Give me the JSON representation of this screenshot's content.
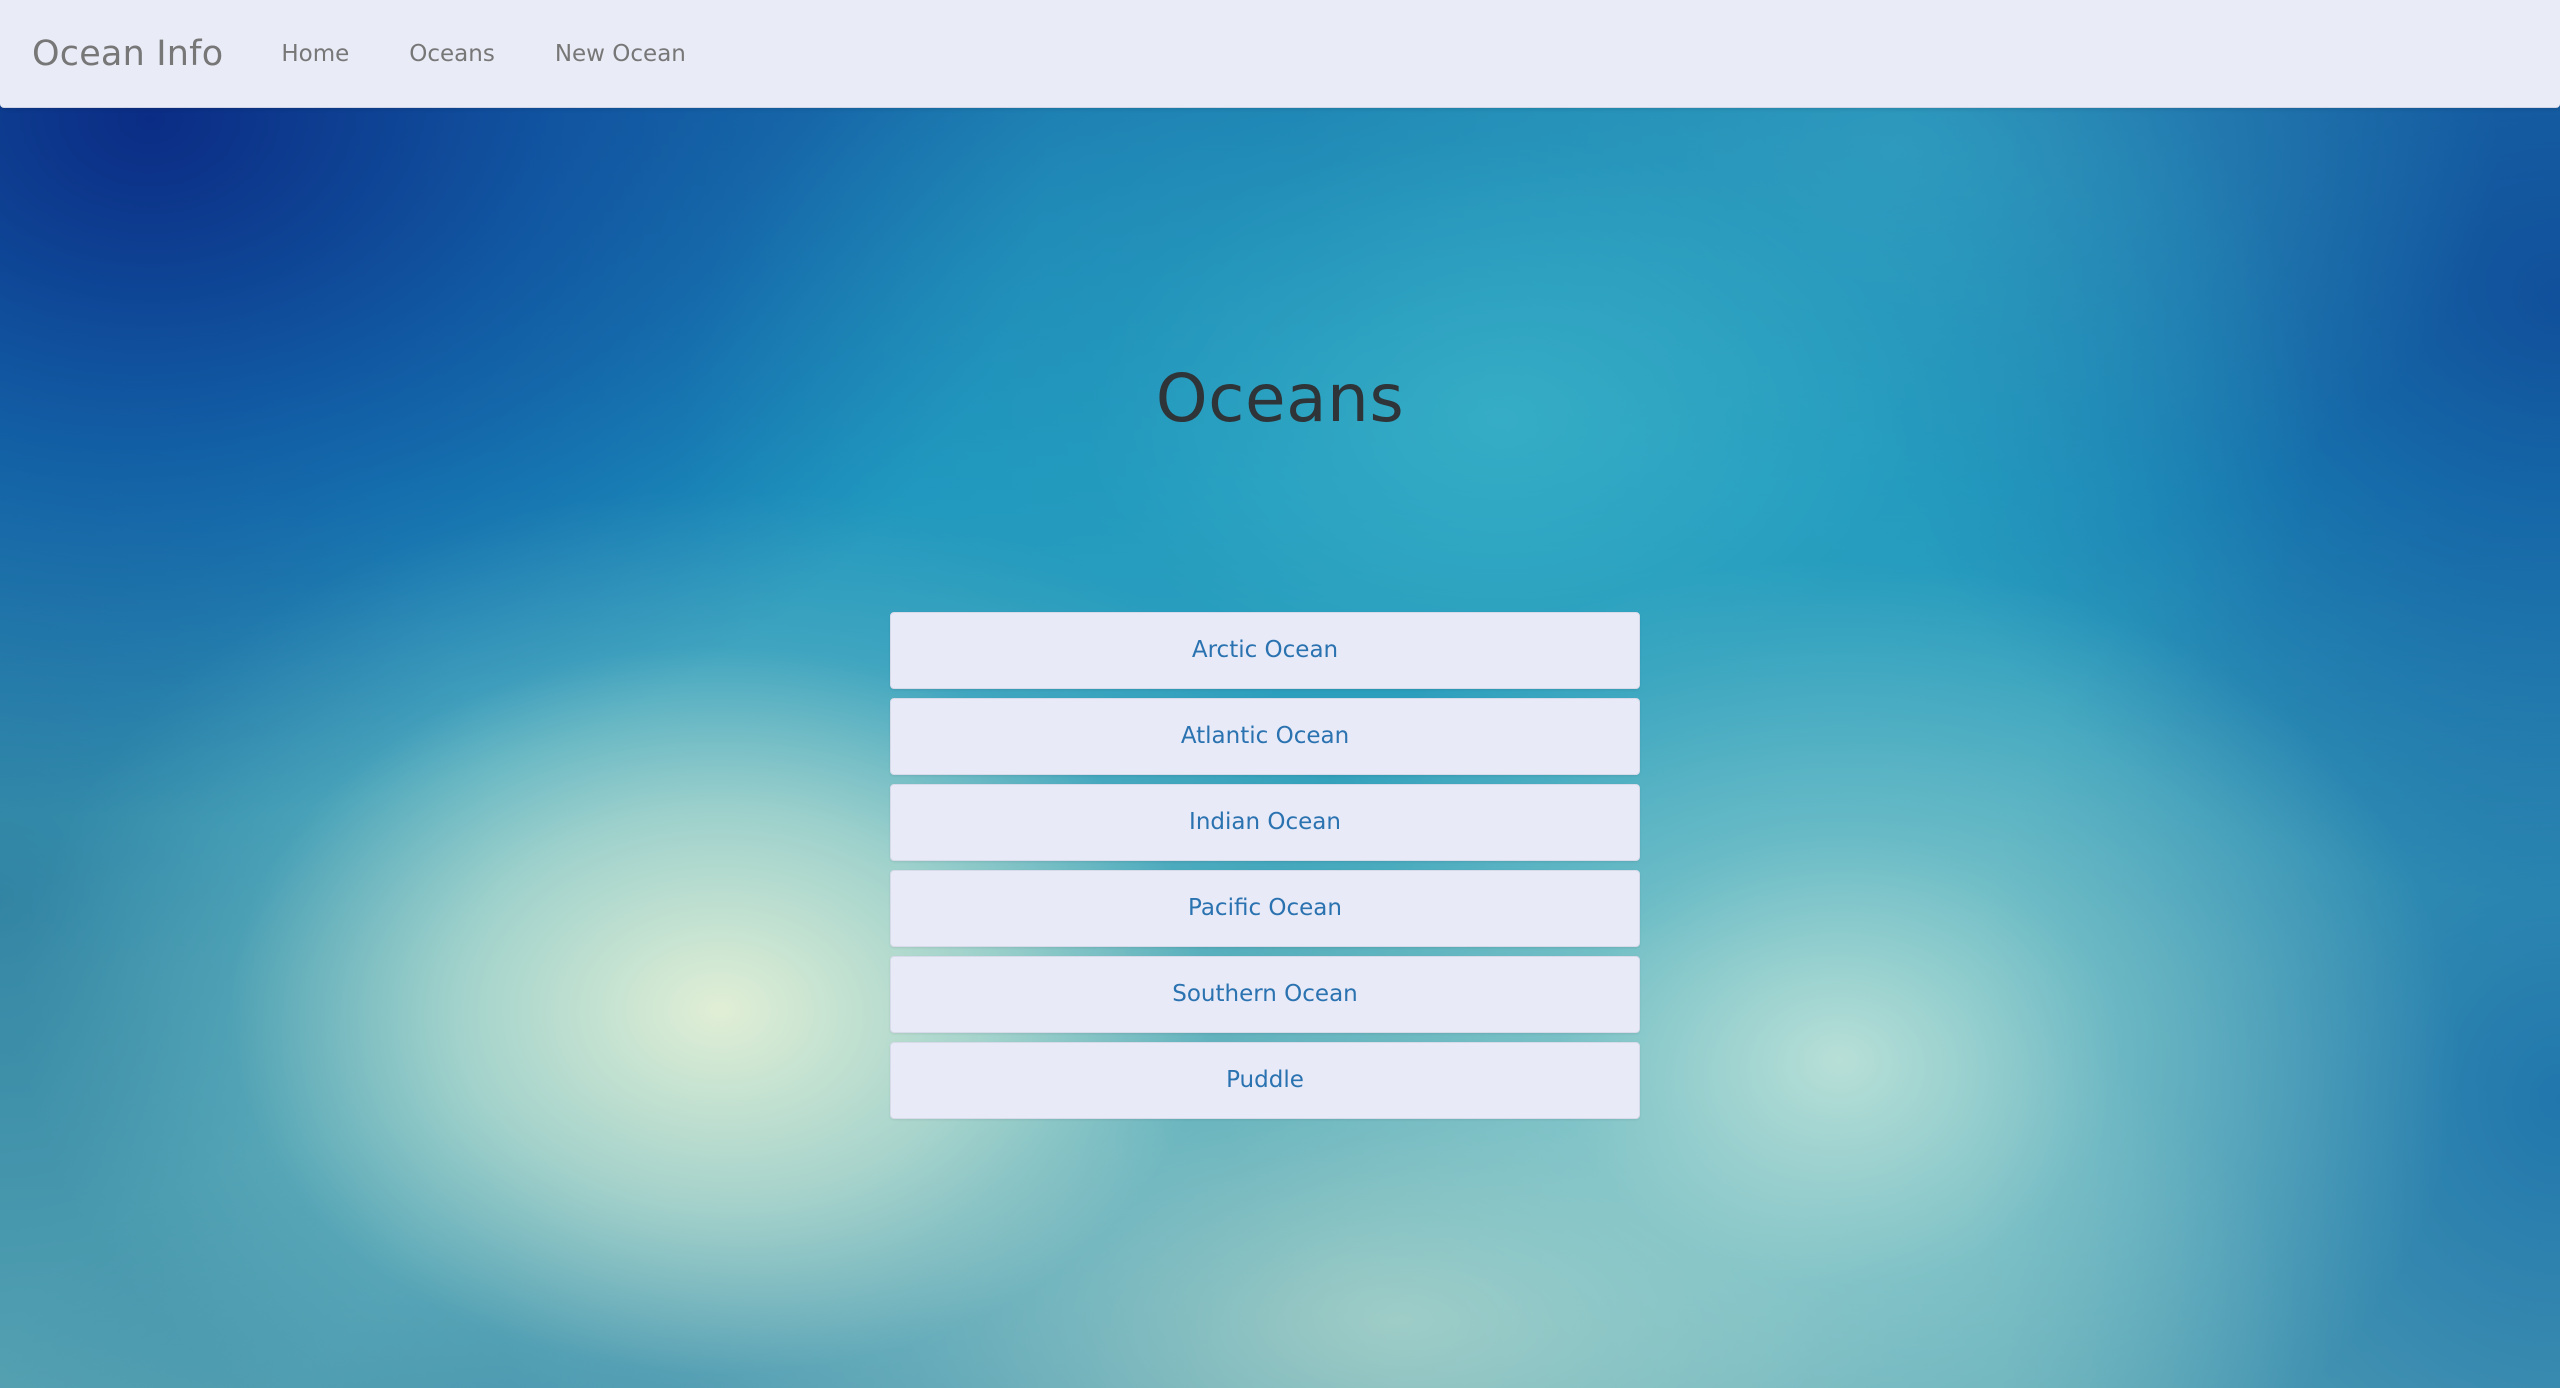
{
  "navbar": {
    "brand": "Ocean Info",
    "links": [
      {
        "label": "Home"
      },
      {
        "label": "Oceans"
      },
      {
        "label": "New Ocean"
      }
    ]
  },
  "main": {
    "title": "Oceans",
    "oceans": [
      {
        "label": "Arctic Ocean"
      },
      {
        "label": "Atlantic Ocean"
      },
      {
        "label": "Indian Ocean"
      },
      {
        "label": "Pacific Ocean"
      },
      {
        "label": "Southern Ocean"
      },
      {
        "label": "Puddle"
      }
    ]
  },
  "colors": {
    "navbar_background": "#e9ebf7",
    "link_text": "#2a72b0",
    "title_text": "#2e3438"
  }
}
